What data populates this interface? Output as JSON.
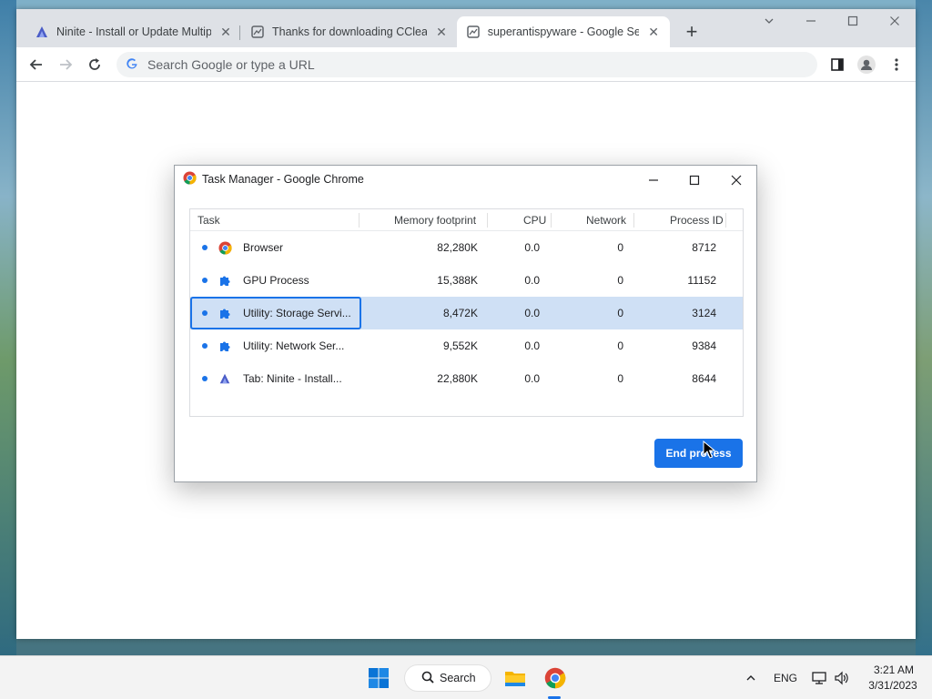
{
  "browser": {
    "tabs": [
      {
        "title": "Ninite - Install or Update Multipl",
        "close": "✕"
      },
      {
        "title": "Thanks for downloading CCleane",
        "close": "✕"
      },
      {
        "title": "superantispyware - Google Sear",
        "close": "✕"
      }
    ],
    "new_tab": "+",
    "omnibox_placeholder": "Search Google or type a URL"
  },
  "task_manager": {
    "title": "Task Manager - Google Chrome",
    "columns": {
      "task": "Task",
      "memory": "Memory footprint",
      "cpu": "CPU",
      "network": "Network",
      "pid": "Process ID"
    },
    "rows": [
      {
        "icon": "chrome-icon",
        "task": "Browser",
        "memory": "82,280K",
        "cpu": "0.0",
        "network": "0",
        "pid": "8712"
      },
      {
        "icon": "puzzle-icon",
        "task": "GPU Process",
        "memory": "15,388K",
        "cpu": "0.0",
        "network": "0",
        "pid": "11152"
      },
      {
        "icon": "puzzle-icon",
        "task": "Utility: Storage Servi...",
        "memory": "8,472K",
        "cpu": "0.0",
        "network": "0",
        "pid": "3124",
        "selected": true
      },
      {
        "icon": "puzzle-icon",
        "task": "Utility: Network Ser...",
        "memory": "9,552K",
        "cpu": "0.0",
        "network": "0",
        "pid": "9384"
      },
      {
        "icon": "ninite-icon",
        "task": "Tab: Ninite - Install...",
        "memory": "22,880K",
        "cpu": "0.0",
        "network": "0",
        "pid": "8644"
      }
    ],
    "end_process_label": "End process"
  },
  "taskbar": {
    "search_label": "Search",
    "language": "ENG",
    "time": "3:21 AM",
    "date": "3/31/2023"
  },
  "colors": {
    "accent": "#1a73e8",
    "selected_row": "#cfe0f5"
  }
}
